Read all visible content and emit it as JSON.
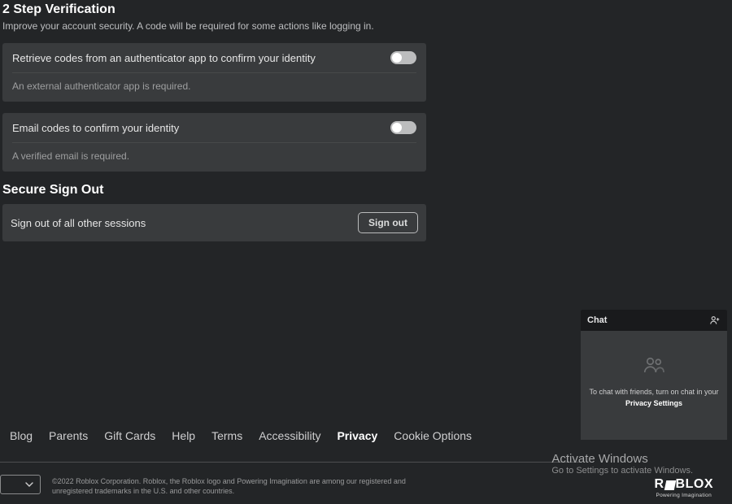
{
  "security": {
    "title": "2 Step Verification",
    "subtitle": "Improve your account security. A code will be required for some actions like logging in.",
    "authenticator": {
      "label": "Retrieve codes from an authenticator app to confirm your identity",
      "desc": "An external authenticator app is required."
    },
    "email": {
      "label": "Email codes to confirm your identity",
      "desc": "A verified email is required."
    }
  },
  "signout": {
    "title": "Secure Sign Out",
    "label": "Sign out of all other sessions",
    "button": "Sign out"
  },
  "footer": {
    "links": [
      "Blog",
      "Parents",
      "Gift Cards",
      "Help",
      "Terms",
      "Accessibility",
      "Privacy",
      "Cookie Options"
    ],
    "active": "Privacy",
    "legal": "©2022 Roblox Corporation. Roblox, the Roblox logo and Powering Imagination are among our registered and unregistered trademarks in the U.S. and other countries."
  },
  "chat": {
    "title": "Chat",
    "msg_pre": "To chat with friends, turn on chat in your ",
    "msg_link": "Privacy Settings"
  },
  "watermark": {
    "line1": "Activate Windows",
    "line2": "Go to Settings to activate Windows."
  },
  "brand": {
    "tagline": "Powering Imagination"
  }
}
